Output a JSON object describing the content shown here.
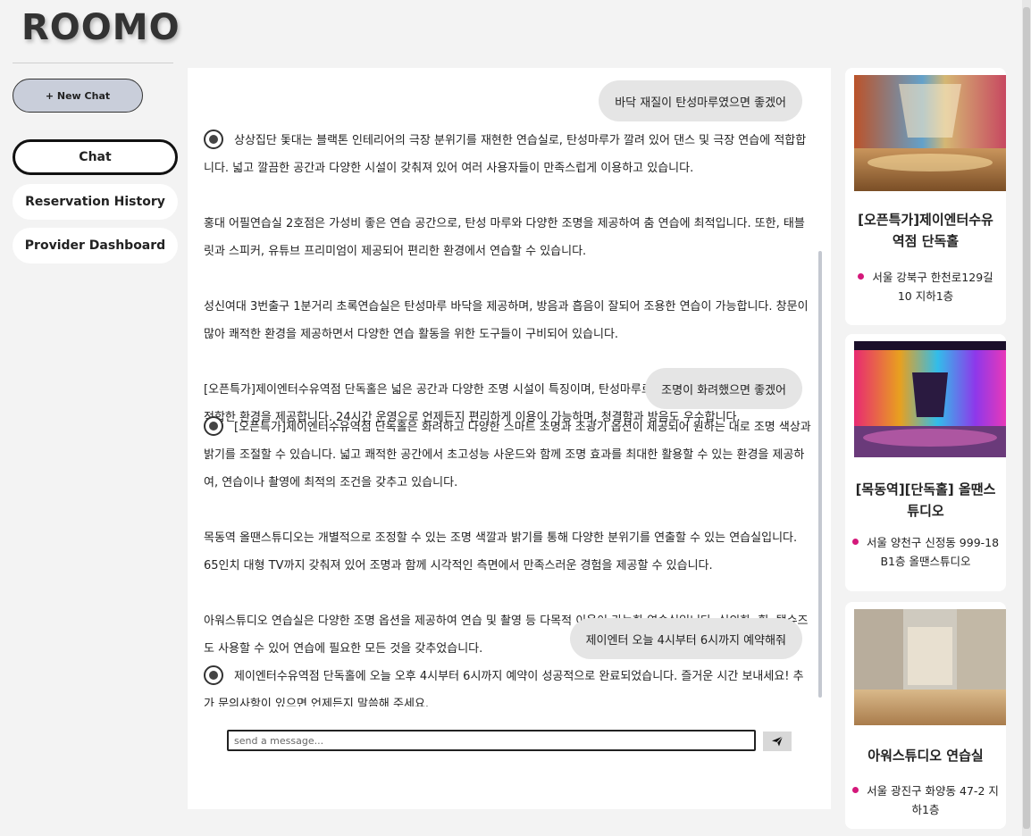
{
  "app": {
    "logo": "ROOMO"
  },
  "sidebar": {
    "new_chat": "+ New Chat",
    "nav": [
      {
        "label": "Chat",
        "active": true
      },
      {
        "label": "Reservation History"
      },
      {
        "label": "Provider Dashboard"
      }
    ]
  },
  "chat": {
    "messages": [
      {
        "role": "user",
        "text": "바닥 재질이 탄성마루였으면 좋겠어"
      },
      {
        "role": "bot",
        "paragraphs": [
          "상상집단 돛대는 블랙톤 인테리어의 극장 분위기를 재현한 연습실로, 탄성마루가 깔려 있어 댄스 및 극장 연습에 적합합니다. 넓고 깔끔한 공간과 다양한 시설이 갖춰져 있어 여러 사용자들이 만족스럽게 이용하고 있습니다.",
          "홍대 어필연습실 2호점은 가성비 좋은 연습 공간으로, 탄성 마루와 다양한 조명을 제공하여 춤 연습에 최적입니다. 또한, 태블릿과 스피커, 유튜브 프리미엄이 제공되어 편리한 환경에서 연습할 수 있습니다.",
          "성신여대 3번출구 1분거리 초록연습실은 탄성마루 바닥을 제공하며, 방음과 흡음이 잘되어 조용한 연습이 가능합니다. 창문이 많아 쾌적한 환경을 제공하면서 다양한 연습 활동을 위한 도구들이 구비되어 있습니다.",
          "[오픈특가]제이엔터수유역점 단독홀은 넓은 공간과 다양한 조명 시설이 특징이며, 탄성마루로 구성되어 있어 춤이나 연습 시 적합한 환경을 제공합니다. 24시간 운영으로 언제든지 편리하게 이용이 가능하며, 청결함과 방음도 우수합니다."
        ]
      },
      {
        "role": "user",
        "text": "조명이 화려했으면 좋겠어"
      },
      {
        "role": "bot",
        "paragraphs": [
          "[오픈특가]제이엔터수유역점 단독홀은 화려하고 다양한 스마트 조명과 조광기 옵션이 제공되어 원하는 대로 조명 색상과 밝기를 조절할 수 있습니다. 넓고 쾌적한 공간에서 초고성능 사운드와 함께 조명 효과를 최대한 활용할 수 있는 환경을 제공하여, 연습이나 촬영에 최적의 조건을 갖추고 있습니다.",
          "목동역 올땐스튜디오는 개별적으로 조정할 수 있는 조명 색깔과 밝기를 통해 다양한 분위기를 연출할 수 있는 연습실입니다. 65인치 대형 TV까지 갖춰져 있어 조명과 함께 시각적인 측면에서 만족스러운 경험을 제공할 수 있습니다.",
          "아워스튜디오 연습실은 다양한 조명 옵션을 제공하여 연습 및 촬영 등 다목적 이용이 가능한 연습실입니다. 실외화, 힐, 탭슈즈도 사용할 수 있어 연습에 필요한 모든 것을 갖추었습니다."
        ]
      },
      {
        "role": "user",
        "text": "제이엔터 오늘 4시부터 6시까지 예약해줘"
      },
      {
        "role": "bot",
        "paragraphs": [
          "제이엔터수유역점 단독홀에 오늘 오후 4시부터 6시까지 예약이 성공적으로 완료되었습니다. 즐거운 시간 보내세요! 추가 문의사항이 있으면 언제든지 말씀해 주세요."
        ]
      }
    ],
    "input_placeholder": "send a message..."
  },
  "cards": [
    {
      "title": "[오픈특가]제이엔터수유역점 단독홀",
      "address": "서울 강북구 한천로129길 10 지하1층"
    },
    {
      "title": "[목동역][단독홀] 올땐스튜디오",
      "address": "서울 양천구 신정동 999-18 B1층 올땐스튜디오"
    },
    {
      "title": "아워스튜디오 연습실",
      "address": "서울 광진구 화양동 47-2 지하1층"
    }
  ],
  "colors": {
    "accent_pin": "#d4187a",
    "new_chat_bg": "#c9ceda"
  }
}
